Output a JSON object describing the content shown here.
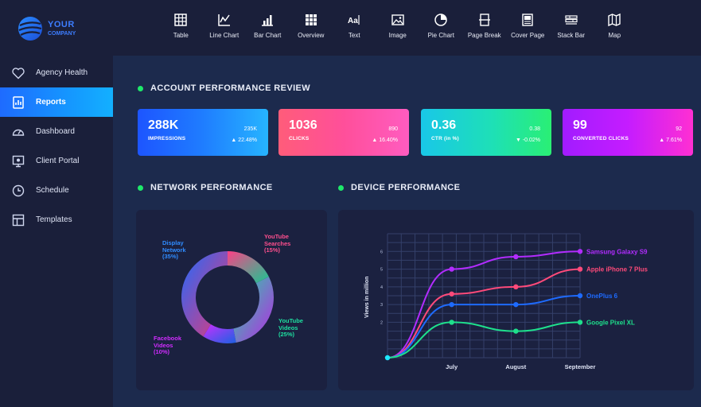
{
  "brand": {
    "line1": "YOUR",
    "line2": "COMPANY"
  },
  "toolbar": [
    {
      "label": "Table",
      "icon": "table-icon"
    },
    {
      "label": "Line Chart",
      "icon": "line-chart-icon"
    },
    {
      "label": "Bar Chart",
      "icon": "bar-chart-icon"
    },
    {
      "label": "Overview",
      "icon": "grid-icon"
    },
    {
      "label": "Text",
      "icon": "text-icon"
    },
    {
      "label": "Image",
      "icon": "image-icon"
    },
    {
      "label": "Pie Chart",
      "icon": "pie-chart-icon"
    },
    {
      "label": "Page Break",
      "icon": "page-break-icon"
    },
    {
      "label": "Cover Page",
      "icon": "cover-page-icon"
    },
    {
      "label": "Stack Bar",
      "icon": "stack-bar-icon"
    },
    {
      "label": "Map",
      "icon": "map-icon"
    }
  ],
  "sidebar": {
    "items": [
      {
        "label": "Agency Health",
        "icon": "heart-icon",
        "active": false
      },
      {
        "label": "Reports",
        "icon": "report-icon",
        "active": true
      },
      {
        "label": "Dashboard",
        "icon": "gauge-icon",
        "active": false
      },
      {
        "label": "Client Portal",
        "icon": "monitor-icon",
        "active": false
      },
      {
        "label": "Schedule",
        "icon": "clock-icon",
        "active": false
      },
      {
        "label": "Templates",
        "icon": "template-icon",
        "active": false
      }
    ]
  },
  "sections": {
    "account": "ACCOUNT PERFORMANCE REVIEW",
    "network": "NETWORK PERFORMANCE",
    "device": "DEVICE PERFORMANCE"
  },
  "kpis": [
    {
      "value": "288K",
      "label": "IMPRESSIONS",
      "previous": "235K",
      "change": "▲ 22.48%"
    },
    {
      "value": "1036",
      "label": "CLICKS",
      "previous": "890",
      "change": "▲ 16.40%"
    },
    {
      "value": "0.36",
      "label": "CTR (in %)",
      "previous": "0.38",
      "change": "▼ -0.02%"
    },
    {
      "value": "99",
      "label": "CONVERTED CLICKS",
      "previous": "92",
      "change": "▲ 7.61%"
    }
  ],
  "network_labels": {
    "display": [
      "Display",
      "Network",
      "(35%)"
    ],
    "yt_searches": [
      "YouTube",
      "Searches",
      "(15%)"
    ],
    "yt_videos": [
      "YouTube",
      "Videos",
      "(25%)"
    ],
    "facebook": [
      "Facebook",
      "Videos",
      "(10%)"
    ]
  },
  "chart_data": [
    {
      "type": "pie",
      "title": "NETWORK PERFORMANCE",
      "categories": [
        "Display Network",
        "YouTube Searches",
        "YouTube Videos",
        "Facebook Videos"
      ],
      "values": [
        35,
        15,
        25,
        10
      ],
      "labels": [
        "(35%)",
        "(15%)",
        "(25%)",
        "(10%)"
      ],
      "colors": [
        "#1e6bff",
        "#ff3f86",
        "#1ee0a0",
        "#d12cff"
      ]
    },
    {
      "type": "line",
      "title": "DEVICE PERFORMANCE",
      "ylabel": "Views in million",
      "xlabel": "",
      "categories": [
        "",
        "July",
        "August",
        "September"
      ],
      "ylim": [
        0,
        7
      ],
      "yticks": [
        2,
        3,
        4,
        5,
        6
      ],
      "series": [
        {
          "name": "Samsung Galaxy S9",
          "values": [
            0,
            5,
            5.7,
            6
          ],
          "color": "#b22cff"
        },
        {
          "name": "Apple iPhone 7 Plus",
          "values": [
            0,
            3.6,
            4,
            5
          ],
          "color": "#ff4a7a"
        },
        {
          "name": "OnePlus 6",
          "values": [
            0,
            3,
            3,
            3.5
          ],
          "color": "#1e6bff"
        },
        {
          "name": "Google Pixel XL",
          "values": [
            0,
            2,
            1.5,
            2
          ],
          "color": "#1ee08c"
        }
      ]
    }
  ],
  "device_legend": [
    "Samsung Galaxy S9",
    "Apple iPhone 7 Plus",
    "OnePlus 6",
    "Google Pixel XL"
  ],
  "device_xlabels": [
    "July",
    "August",
    "September"
  ],
  "device_ylabel": "Views in million",
  "colors": {
    "accent": "#1e6bff",
    "green_dot": "#1ee86a",
    "sidebar_bg": "#1a1f3a",
    "main_bg": "#1c2a4d"
  }
}
